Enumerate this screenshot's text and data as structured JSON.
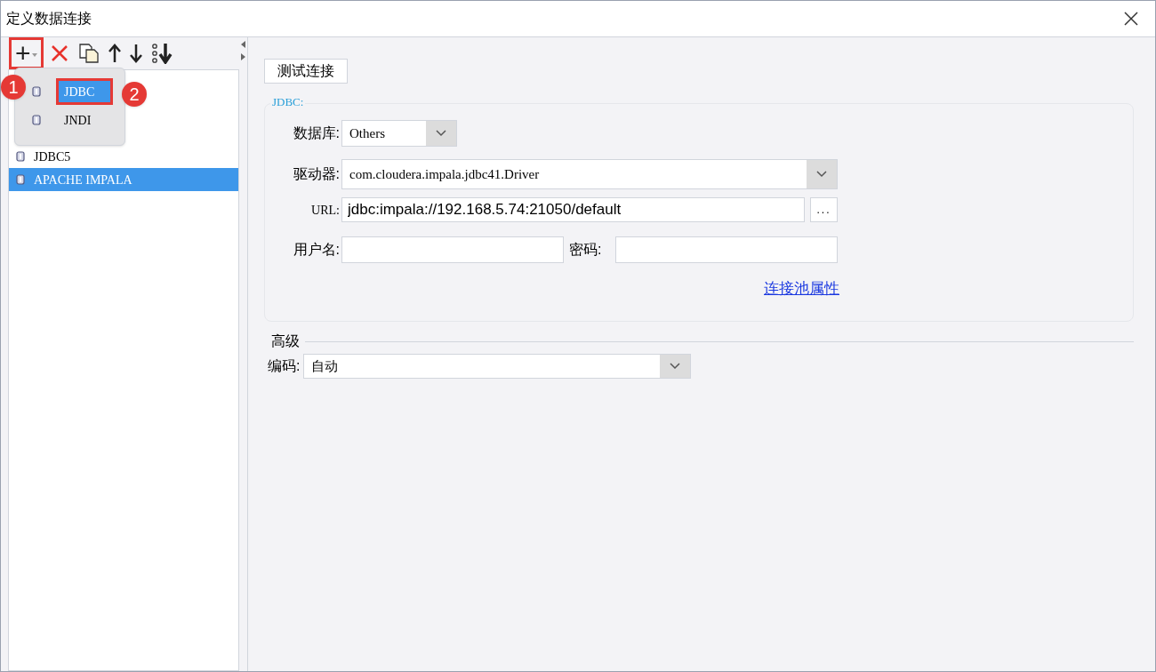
{
  "window": {
    "title": "定义数据连接"
  },
  "toolbar": [
    {
      "kind": "add",
      "label": "+"
    },
    {
      "kind": "delete"
    },
    {
      "kind": "copy"
    },
    {
      "kind": "up"
    },
    {
      "kind": "down"
    },
    {
      "kind": "sort"
    }
  ],
  "popup_menu": [
    {
      "label": "JDBC",
      "selected": true
    },
    {
      "label": "JNDI",
      "selected": false
    }
  ],
  "connections": [
    {
      "label": "JDBC5",
      "selected": false
    },
    {
      "label": "APACHE IMPALA",
      "selected": true
    }
  ],
  "annotations": [
    {
      "text": "1"
    },
    {
      "text": "2"
    }
  ],
  "test_button": "测试连接",
  "jdbc_group": {
    "title": "JDBC:",
    "database_label": "数据库:",
    "database_value": "Others",
    "driver_label": "驱动器:",
    "driver_value": "com.cloudera.impala.jdbc41.Driver",
    "url_label": "URL:",
    "url_value": "jdbc:impala://192.168.5.74:21050/default",
    "browse_button": "...",
    "username_label": "用户名:",
    "password_label": "密码:",
    "pool_link": "连接池属性"
  },
  "advanced": {
    "title": "高级",
    "encoding_label": "编码:",
    "encoding_value": "自动"
  }
}
